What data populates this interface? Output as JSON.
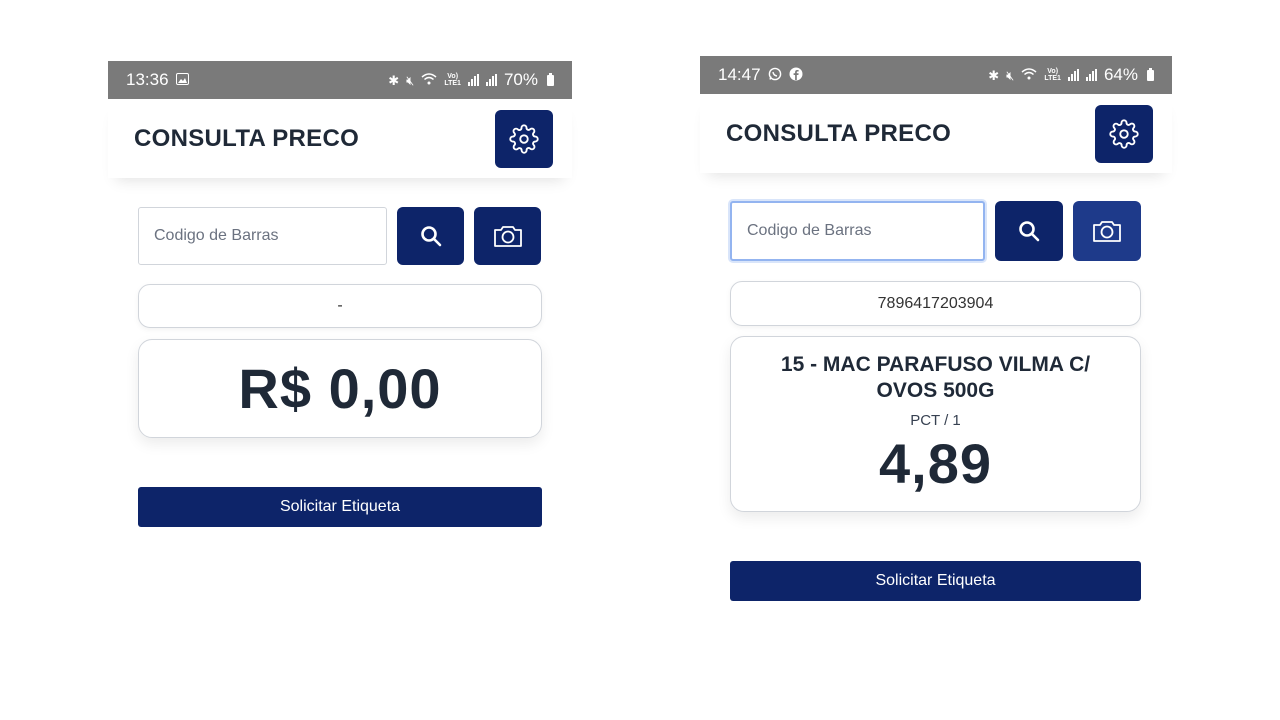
{
  "screens": [
    {
      "status": {
        "time": "13:36",
        "battery": "70%"
      },
      "title": "CONSULTA PRECO",
      "search": {
        "placeholder": "Codigo de Barras",
        "value": ""
      },
      "barcode_display": "-",
      "price_display": "R$ 0,00",
      "label_button": "Solicitar Etiqueta"
    },
    {
      "status": {
        "time": "14:47",
        "battery": "64%"
      },
      "title": "CONSULTA PRECO",
      "search": {
        "placeholder": "Codigo de Barras",
        "value": ""
      },
      "barcode_display": "7896417203904",
      "product": {
        "name": "15 - MAC PARAFUSO VILMA C/ OVOS 500G",
        "unit": "PCT / 1",
        "price": "4,89"
      },
      "label_button": "Solicitar Etiqueta"
    }
  ],
  "icons": {
    "settings": "gear-icon",
    "search": "search-icon",
    "camera": "camera-icon",
    "gallery": "image-icon",
    "whatsapp": "whatsapp-icon",
    "facebook": "facebook-icon",
    "bluetooth": "bluetooth-icon",
    "mute": "mute-icon",
    "wifi": "wifi-icon",
    "signal": "signal-icon",
    "battery": "battery-icon"
  },
  "colors": {
    "primary": "#0d2469",
    "status_bar": "#7a7a7a",
    "text": "#1f2937",
    "input_focus": "#93b4f0"
  }
}
